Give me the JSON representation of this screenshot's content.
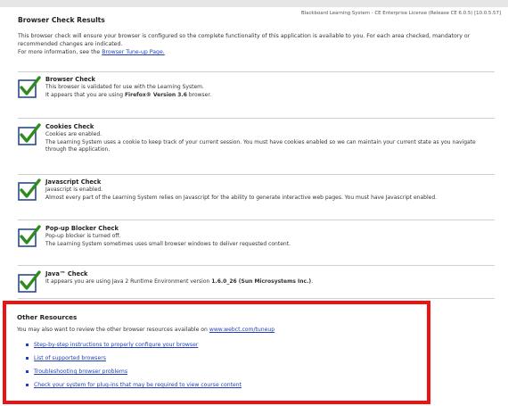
{
  "header_info": "Blackboard Learning System - CE Enterprise License (Release CE 6.0.5) [10.0.5.57]",
  "page_title": "Browser Check Results",
  "intro": {
    "text": "This browser check will ensure your browser is configured so the complete functionality of this application is available to you. For each area checked, mandatory or recommended changes are indicated.",
    "more_prefix": "For more information, see the ",
    "more_link": "Browser Tune-up Page."
  },
  "checks": [
    {
      "title": "Browser Check",
      "line1": "This browser is validated for use with the Learning System.",
      "line2_prefix": "It appears that you are using ",
      "line2_bold": "Firefox® Version 3.6",
      "line2_suffix": " browser."
    },
    {
      "title": "Cookies Check",
      "line1": "Cookies are enabled.",
      "line2": "The Learning System uses a cookie to keep track of your current session. You must have cookies enabled so we can maintain your current state as you navigate through the application."
    },
    {
      "title": "Javascript Check",
      "line1": "Javascript is enabled.",
      "line2": "Almost every part of the Learning System relies on Javascript for the ability to generate interactive web pages. You must have Javascript enabled."
    },
    {
      "title": "Pop-up Blocker Check",
      "line1": "Pop-up blocker is turned off.",
      "line2": "The Learning System sometimes uses small browser windows to deliver requested content."
    },
    {
      "title": "Java™ Check",
      "line1_prefix": "It appears you are using Java 2 Runtime Environment version ",
      "line1_bold": "1.6.0_26 (Sun Microsystems Inc.)",
      "line1_suffix": "."
    }
  ],
  "resources": {
    "title": "Other Resources",
    "intro_prefix": "You may also want to review the other browser resources available on ",
    "intro_link": "www.webct.com/tuneup",
    "links": [
      "Step-by-step instructions to properly configure your browser",
      "List of supported browsers",
      "Troubleshooting browser problems",
      "Check your system for plug-ins that may be required to view course content"
    ]
  },
  "colors": {
    "check_mark": "#2e8b1e",
    "highlight_border": "#ee1111",
    "link": "#1f3fb8"
  },
  "icons": {
    "check": "checkbox-checked-icon"
  }
}
